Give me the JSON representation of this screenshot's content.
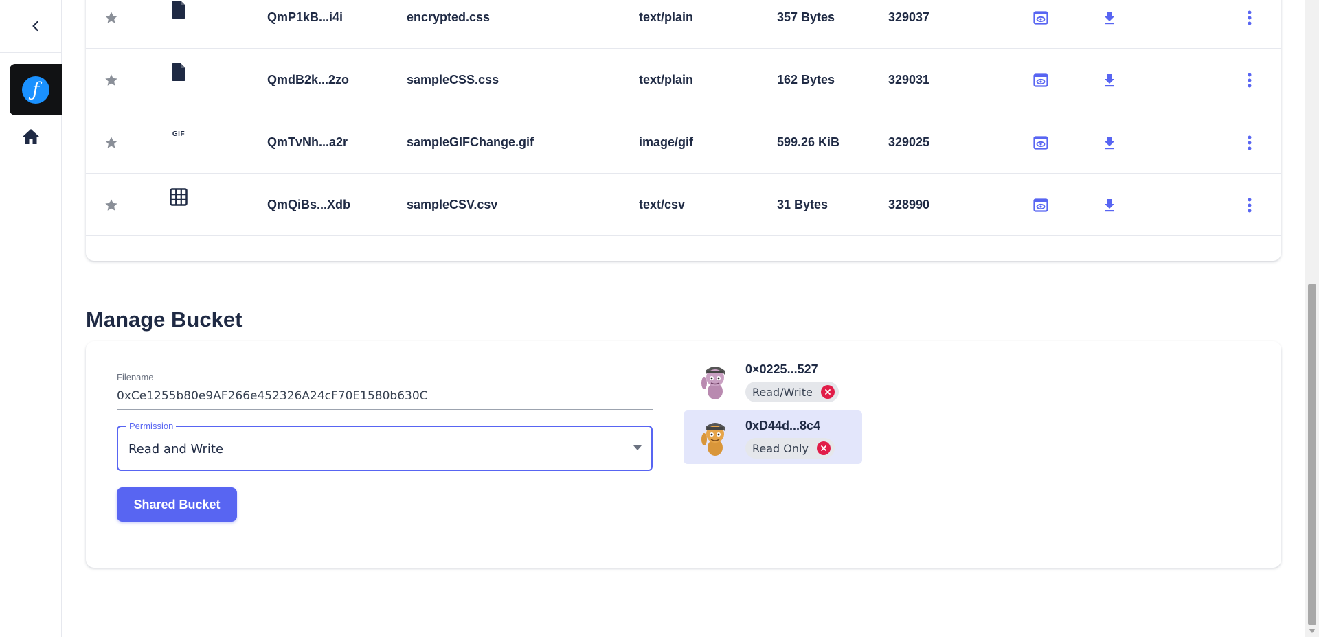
{
  "sidebar": {
    "collapse_icon": "chevron-left-icon",
    "app_logo_icon": "filecoin-logo-icon",
    "app_logo_glyph": "ƒ",
    "home_icon": "home-icon"
  },
  "files": [
    {
      "cid": "QmP1kB...i4i",
      "name": "encrypted.css",
      "mime": "text/plain",
      "size": "357 Bytes",
      "id": "329037",
      "type_icon": "file-icon"
    },
    {
      "cid": "QmdB2k...2zo",
      "name": "sampleCSS.css",
      "mime": "text/plain",
      "size": "162 Bytes",
      "id": "329031",
      "type_icon": "file-icon"
    },
    {
      "cid": "QmTvNh...a2r",
      "name": "sampleGIFChange.gif",
      "mime": "image/gif",
      "size": "599.26 KiB",
      "id": "329025",
      "type_icon": "gif-icon",
      "type_text": "GIF"
    },
    {
      "cid": "QmQiBs...Xdb",
      "name": "sampleCSV.csv",
      "mime": "text/csv",
      "size": "31 Bytes",
      "id": "328990",
      "type_icon": "table-grid-icon"
    }
  ],
  "manage": {
    "title": "Manage Bucket",
    "filename_label": "Filename",
    "filename_value": "0xCe1255b80e9AF266e452326A24cF70E1580b630C",
    "permission_label": "Permission",
    "permission_value": "Read and Write",
    "share_button": "Shared Bucket",
    "members": [
      {
        "address": "0×0225...527",
        "role": "Read/Write",
        "selected": false
      },
      {
        "address": "0xD44d...8c4",
        "role": "Read Only",
        "selected": true
      }
    ]
  },
  "colors": {
    "accent": "#5865f2",
    "text": "#1f2a44",
    "remove": "#e11d48",
    "selected_bg": "#e3e6fb"
  }
}
